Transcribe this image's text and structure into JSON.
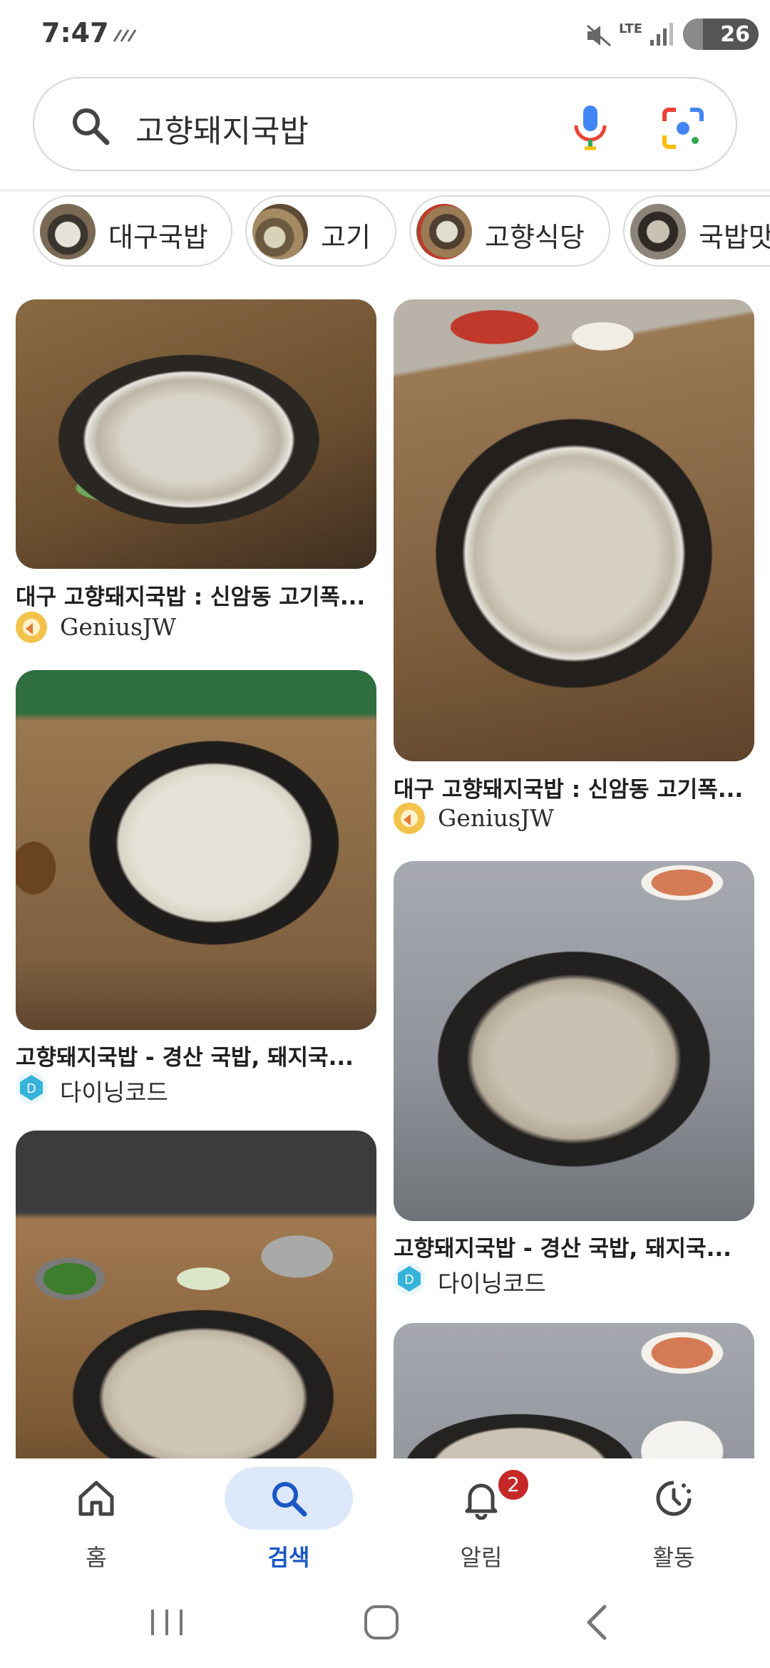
{
  "status_bar": {
    "time": "7:47",
    "network": "LTE",
    "battery": "26",
    "battery_level": 0.26
  },
  "search": {
    "query": "고향돼지국밥"
  },
  "chips": [
    {
      "label": "대구국밥"
    },
    {
      "label": "고기"
    },
    {
      "label": "고향식당"
    },
    {
      "label": "국밥맛"
    }
  ],
  "results": [
    {
      "title": "대구 고향돼지국밥 : 신암동 고기폭...",
      "source": "GeniusJW"
    },
    {
      "title": "대구 고향돼지국밥 : 신암동 고기폭...",
      "source": "GeniusJW"
    },
    {
      "title": "고향돼지국밥 - 경산 국밥, 돼지국...",
      "source": "다이닝코드"
    },
    {
      "title": "고향돼지국밥 - 경산 국밥, 돼지국...",
      "source": "다이닝코드"
    }
  ],
  "bottom_nav": {
    "home": "홈",
    "search": "검색",
    "notifications": "알림",
    "notification_count": "2",
    "activity": "활동"
  },
  "colors": {
    "accent": "#1a57c4",
    "accent_bg": "#dde8fb",
    "badge": "#c62828"
  }
}
